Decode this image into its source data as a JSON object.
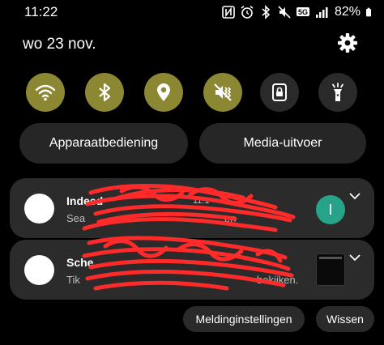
{
  "status_bar": {
    "time": "11:22",
    "battery": "82%",
    "icons": [
      "nfc-icon",
      "alarm-icon",
      "bluetooth-icon",
      "mute-icon",
      "5g-icon",
      "signal-icon",
      "battery-icon"
    ],
    "network_badge": "5G"
  },
  "header": {
    "date": "wo 23 nov."
  },
  "quick_settings": [
    {
      "name": "wifi",
      "state": "on"
    },
    {
      "name": "bluetooth",
      "state": "on"
    },
    {
      "name": "location",
      "state": "on"
    },
    {
      "name": "sound-vibrate",
      "state": "on"
    },
    {
      "name": "screen-rotation-lock",
      "state": "off"
    },
    {
      "name": "flashlight",
      "state": "off"
    }
  ],
  "pills": {
    "device_control": "Apparaatbediening",
    "media_output": "Media-uitvoer"
  },
  "notifications": [
    {
      "title": "Indeed",
      "text": "Sea",
      "time": "11:1",
      "text_tail": "en",
      "avatar_letter": "I"
    },
    {
      "title": "Sche",
      "text": "Tik",
      "text_tail": "bekijken."
    }
  ],
  "actions": {
    "notification_settings": "Meldinginstellingen",
    "clear": "Wissen"
  },
  "colors": {
    "tile_active": "#8b8733",
    "tile_inactive": "#2a2a2a",
    "panel": "#2b2b2b",
    "avatar": "#27a38a",
    "redaction": "#ff2a2a"
  }
}
